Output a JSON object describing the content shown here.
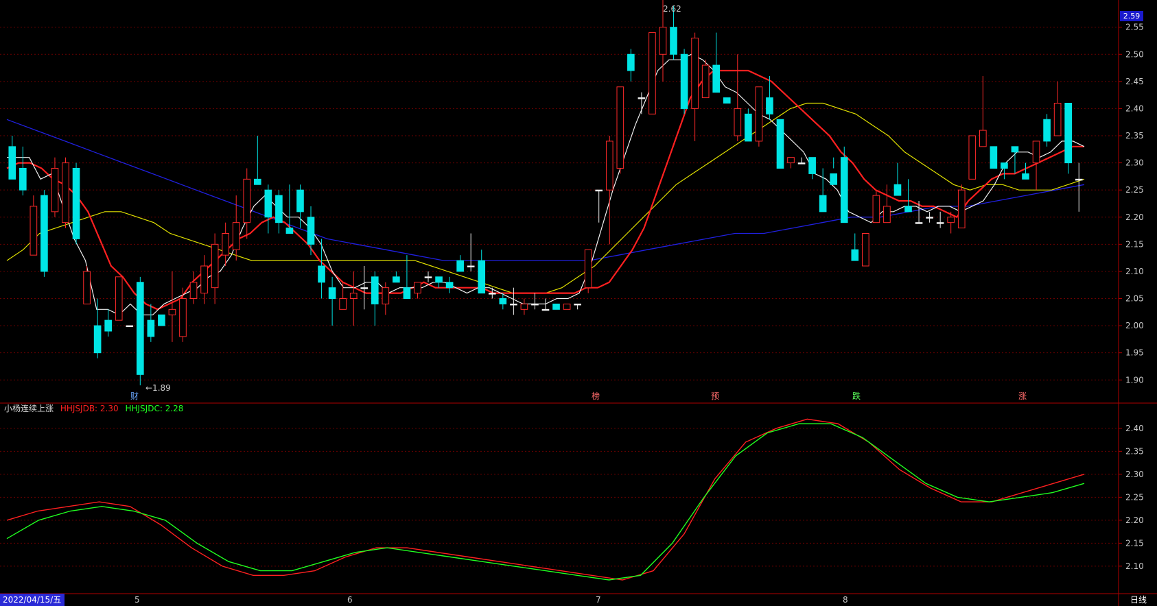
{
  "chart_data": [
    {
      "type": "candlestick",
      "panel": "main",
      "ylim": [
        1.87,
        2.59
      ],
      "y_ticks": [
        "2.55",
        "2.50",
        "2.45",
        "2.40",
        "2.35",
        "2.30",
        "2.25",
        "2.20",
        "2.15",
        "2.10",
        "2.05",
        "2.00",
        "1.95",
        "1.90"
      ],
      "current_price_label": "2.59",
      "annotations": {
        "high_label": "2.62",
        "low_label": "←1.89"
      },
      "candles": [
        [
          2.33,
          2.35,
          2.31,
          2.27
        ],
        [
          2.29,
          2.33,
          2.24,
          2.25
        ],
        [
          2.13,
          2.24,
          2.13,
          2.22
        ],
        [
          2.24,
          2.25,
          2.09,
          2.1
        ],
        [
          2.21,
          2.31,
          2.2,
          2.29
        ],
        [
          2.19,
          2.31,
          2.18,
          2.3
        ],
        [
          2.29,
          2.3,
          2.15,
          2.16
        ],
        [
          2.04,
          2.11,
          2.04,
          2.1
        ],
        [
          2.0,
          2.05,
          1.94,
          1.95
        ],
        [
          2.01,
          2.03,
          1.98,
          1.99
        ],
        [
          2.01,
          2.09,
          2.01,
          2.09
        ],
        [
          2.0,
          2.0,
          2.0,
          2.0
        ],
        [
          2.08,
          2.09,
          1.89,
          1.91
        ],
        [
          2.01,
          2.04,
          1.97,
          1.98
        ],
        [
          2.02,
          2.02,
          2.01,
          2.0
        ],
        [
          2.02,
          2.1,
          1.97,
          2.03
        ],
        [
          1.98,
          2.07,
          1.97,
          2.05
        ],
        [
          2.05,
          2.1,
          2.04,
          2.08
        ],
        [
          2.06,
          2.13,
          2.04,
          2.11
        ],
        [
          2.07,
          2.17,
          2.04,
          2.15
        ],
        [
          2.13,
          2.19,
          2.11,
          2.17
        ],
        [
          2.14,
          2.24,
          2.12,
          2.19
        ],
        [
          2.19,
          2.29,
          2.16,
          2.27
        ],
        [
          2.27,
          2.35,
          2.26,
          2.26
        ],
        [
          2.25,
          2.26,
          2.17,
          2.2
        ],
        [
          2.24,
          2.25,
          2.17,
          2.19
        ],
        [
          2.18,
          2.26,
          2.18,
          2.17
        ],
        [
          2.25,
          2.26,
          2.18,
          2.21
        ],
        [
          2.2,
          2.22,
          2.13,
          2.15
        ],
        [
          2.11,
          2.16,
          2.05,
          2.08
        ],
        [
          2.07,
          2.09,
          2.0,
          2.05
        ],
        [
          2.03,
          2.08,
          2.03,
          2.05
        ],
        [
          2.05,
          2.1,
          2.0,
          2.06
        ],
        [
          2.07,
          2.11,
          2.03,
          2.07
        ],
        [
          2.09,
          2.1,
          2.0,
          2.04
        ],
        [
          2.04,
          2.08,
          2.02,
          2.07
        ],
        [
          2.09,
          2.1,
          2.08,
          2.08
        ],
        [
          2.07,
          2.13,
          2.05,
          2.05
        ],
        [
          2.06,
          2.08,
          2.05,
          2.08
        ],
        [
          2.09,
          2.1,
          2.08,
          2.09
        ],
        [
          2.09,
          2.09,
          2.07,
          2.08
        ],
        [
          2.08,
          2.09,
          2.06,
          2.07
        ],
        [
          2.12,
          2.13,
          2.1,
          2.1
        ],
        [
          2.11,
          2.17,
          2.1,
          2.11
        ],
        [
          2.12,
          2.14,
          2.06,
          2.06
        ],
        [
          2.06,
          2.07,
          2.05,
          2.06
        ],
        [
          2.05,
          2.06,
          2.03,
          2.04
        ],
        [
          2.04,
          2.07,
          2.02,
          2.04
        ],
        [
          2.03,
          2.05,
          2.02,
          2.04
        ],
        [
          2.04,
          2.06,
          2.03,
          2.04
        ],
        [
          2.03,
          2.05,
          2.03,
          2.03
        ],
        [
          2.04,
          2.04,
          2.03,
          2.03
        ],
        [
          2.03,
          2.04,
          2.03,
          2.04
        ],
        [
          2.04,
          2.04,
          2.03,
          2.04
        ],
        [
          2.07,
          2.14,
          2.06,
          2.14
        ],
        [
          2.25,
          2.25,
          2.19,
          2.25
        ],
        [
          2.25,
          2.35,
          2.15,
          2.34
        ],
        [
          2.29,
          2.44,
          2.28,
          2.44
        ],
        [
          2.5,
          2.51,
          2.45,
          2.47
        ],
        [
          2.42,
          2.43,
          2.39,
          2.42
        ],
        [
          2.39,
          2.54,
          2.39,
          2.54
        ],
        [
          2.5,
          2.62,
          2.45,
          2.55
        ],
        [
          2.55,
          2.59,
          2.49,
          2.5
        ],
        [
          2.5,
          2.51,
          2.39,
          2.4
        ],
        [
          2.4,
          2.54,
          2.34,
          2.53
        ],
        [
          2.42,
          2.49,
          2.42,
          2.48
        ],
        [
          2.48,
          2.54,
          2.43,
          2.43
        ],
        [
          2.42,
          2.42,
          2.41,
          2.41
        ],
        [
          2.35,
          2.5,
          2.34,
          2.4
        ],
        [
          2.39,
          2.4,
          2.35,
          2.34
        ],
        [
          2.34,
          2.44,
          2.33,
          2.44
        ],
        [
          2.42,
          2.46,
          2.38,
          2.39
        ],
        [
          2.38,
          2.38,
          2.29,
          2.29
        ],
        [
          2.3,
          2.31,
          2.29,
          2.31
        ],
        [
          2.3,
          2.31,
          2.3,
          2.3
        ],
        [
          2.31,
          2.31,
          2.27,
          2.28
        ],
        [
          2.24,
          2.29,
          2.24,
          2.21
        ],
        [
          2.28,
          2.31,
          2.29,
          2.26
        ],
        [
          2.31,
          2.33,
          2.27,
          2.19
        ],
        [
          2.14,
          2.17,
          2.14,
          2.12
        ],
        [
          2.11,
          2.17,
          2.11,
          2.17
        ],
        [
          2.19,
          2.25,
          2.19,
          2.24
        ],
        [
          2.19,
          2.26,
          2.19,
          2.22
        ],
        [
          2.26,
          2.3,
          2.26,
          2.24
        ],
        [
          2.22,
          2.27,
          2.22,
          2.21
        ],
        [
          2.19,
          2.23,
          2.19,
          2.19
        ],
        [
          2.2,
          2.21,
          2.19,
          2.2
        ],
        [
          2.19,
          2.21,
          2.18,
          2.19
        ],
        [
          2.19,
          2.21,
          2.17,
          2.2
        ],
        [
          2.18,
          2.26,
          2.18,
          2.25
        ],
        [
          2.27,
          2.35,
          2.27,
          2.35
        ],
        [
          2.33,
          2.46,
          2.33,
          2.36
        ],
        [
          2.33,
          2.34,
          2.34,
          2.29
        ],
        [
          2.3,
          2.29,
          2.27,
          2.29
        ],
        [
          2.33,
          2.33,
          2.28,
          2.32
        ],
        [
          2.28,
          2.3,
          2.27,
          2.27
        ],
        [
          2.3,
          2.34,
          2.25,
          2.34
        ],
        [
          2.38,
          2.39,
          2.33,
          2.34
        ],
        [
          2.35,
          2.45,
          2.35,
          2.41
        ],
        [
          2.41,
          2.41,
          2.28,
          2.3
        ],
        [
          2.27,
          2.3,
          2.21,
          2.27
        ]
      ],
      "ma_white": [
        2.31,
        2.31,
        2.31,
        2.27,
        2.28,
        2.22,
        2.16,
        2.12,
        2.03,
        2.03,
        2.02,
        2.04,
        2.02,
        2.02,
        2.04,
        2.05,
        2.06,
        2.07,
        2.09,
        2.1,
        2.13,
        2.18,
        2.22,
        2.24,
        2.22,
        2.2,
        2.2,
        2.18,
        2.15,
        2.1,
        2.07,
        2.07,
        2.08,
        2.08,
        2.06,
        2.07,
        2.07,
        2.07,
        2.08,
        2.08,
        2.07,
        2.06,
        2.07,
        2.07,
        2.06,
        2.05,
        2.04,
        2.04,
        2.04,
        2.05,
        2.05,
        2.06,
        2.11,
        2.18,
        2.25,
        2.31,
        2.37,
        2.42,
        2.47,
        2.49,
        2.49,
        2.5,
        2.49,
        2.47,
        2.44,
        2.43,
        2.41,
        2.39,
        2.38,
        2.36,
        2.34,
        2.32,
        2.28,
        2.27,
        2.25,
        2.21,
        2.2,
        2.19,
        2.21,
        2.21,
        2.22,
        2.22,
        2.21,
        2.22,
        2.22,
        2.21,
        2.22,
        2.23,
        2.26,
        2.3,
        2.32,
        2.32,
        2.31,
        2.32,
        2.34,
        2.34,
        2.33
      ],
      "ma_red": [
        2.29,
        2.3,
        2.3,
        2.29,
        2.27,
        2.26,
        2.24,
        2.21,
        2.16,
        2.11,
        2.09,
        2.06,
        2.04,
        2.03,
        2.04,
        2.05,
        2.08,
        2.1,
        2.12,
        2.14,
        2.16,
        2.17,
        2.19,
        2.2,
        2.19,
        2.17,
        2.15,
        2.12,
        2.1,
        2.08,
        2.07,
        2.06,
        2.06,
        2.06,
        2.06,
        2.07,
        2.08,
        2.07,
        2.07,
        2.07,
        2.07,
        2.07,
        2.06,
        2.06,
        2.06,
        2.06,
        2.06,
        2.06,
        2.06,
        2.06,
        2.07,
        2.07,
        2.08,
        2.11,
        2.14,
        2.18,
        2.24,
        2.3,
        2.36,
        2.42,
        2.45,
        2.47,
        2.47,
        2.47,
        2.47,
        2.46,
        2.45,
        2.43,
        2.41,
        2.39,
        2.37,
        2.35,
        2.32,
        2.3,
        2.27,
        2.25,
        2.24,
        2.23,
        2.23,
        2.22,
        2.22,
        2.21,
        2.2,
        2.23,
        2.25,
        2.27,
        2.28,
        2.28,
        2.29,
        2.3,
        2.31,
        2.32,
        2.33,
        2.33
      ],
      "ma_yellow": [
        2.12,
        2.14,
        2.17,
        2.18,
        2.19,
        2.2,
        2.21,
        2.21,
        2.2,
        2.19,
        2.17,
        2.16,
        2.15,
        2.14,
        2.13,
        2.12,
        2.12,
        2.12,
        2.12,
        2.12,
        2.12,
        2.12,
        2.12,
        2.12,
        2.12,
        2.12,
        2.11,
        2.1,
        2.09,
        2.08,
        2.07,
        2.06,
        2.06,
        2.06,
        2.07,
        2.09,
        2.11,
        2.14,
        2.17,
        2.2,
        2.23,
        2.26,
        2.28,
        2.3,
        2.32,
        2.34,
        2.36,
        2.38,
        2.4,
        2.41,
        2.41,
        2.4,
        2.39,
        2.37,
        2.35,
        2.32,
        2.3,
        2.28,
        2.26,
        2.25,
        2.26,
        2.26,
        2.25,
        2.25,
        2.25,
        2.26,
        2.27
      ],
      "ma_blue": [
        2.38,
        2.36,
        2.34,
        2.32,
        2.3,
        2.28,
        2.26,
        2.24,
        2.22,
        2.2,
        2.18,
        2.16,
        2.15,
        2.14,
        2.13,
        2.12,
        2.12,
        2.12,
        2.12,
        2.12,
        2.12,
        2.13,
        2.14,
        2.15,
        2.16,
        2.17,
        2.17,
        2.18,
        2.19,
        2.2,
        2.2,
        2.21,
        2.22,
        2.22,
        2.23,
        2.24,
        2.25,
        2.26
      ],
      "event_markers": [
        {
          "label": "财",
          "color": "#6aa8ff"
        },
        {
          "label": "榜",
          "color": "#ff6b6b"
        },
        {
          "label": "预",
          "color": "#ff6b6b"
        },
        {
          "label": "跌",
          "color": "#5bff5b"
        },
        {
          "label": "涨",
          "color": "#ff6b6b"
        }
      ]
    },
    {
      "type": "line",
      "panel": "indicator",
      "title": "小杨连续上涨",
      "ylim": [
        2.07,
        2.44
      ],
      "y_ticks": [
        "2.40",
        "2.35",
        "2.30",
        "2.25",
        "2.20",
        "2.15",
        "2.10"
      ],
      "series": [
        {
          "name": "HHJSJDB",
          "label": "HHJSJDB: 2.30",
          "color": "#ff2020",
          "values": [
            2.2,
            2.22,
            2.23,
            2.24,
            2.23,
            2.19,
            2.14,
            2.1,
            2.08,
            2.08,
            2.09,
            2.12,
            2.14,
            2.14,
            2.13,
            2.12,
            2.11,
            2.1,
            2.09,
            2.08,
            2.07,
            2.09,
            2.17,
            2.29,
            2.37,
            2.4,
            2.42,
            2.41,
            2.37,
            2.31,
            2.27,
            2.24,
            2.24,
            2.26,
            2.28,
            2.3
          ]
        },
        {
          "name": "HHJSJDC",
          "label": "HHJSJDC: 2.28",
          "color": "#20ff20",
          "values": [
            2.16,
            2.2,
            2.22,
            2.23,
            2.22,
            2.2,
            2.15,
            2.11,
            2.09,
            2.09,
            2.11,
            2.13,
            2.14,
            2.13,
            2.12,
            2.11,
            2.1,
            2.09,
            2.08,
            2.07,
            2.08,
            2.15,
            2.25,
            2.34,
            2.39,
            2.41,
            2.41,
            2.38,
            2.33,
            2.28,
            2.25,
            2.24,
            2.25,
            2.26,
            2.28
          ]
        }
      ]
    }
  ],
  "x_axis": {
    "date_label": "2022/04/15/五",
    "month_labels": [
      "5",
      "6",
      "7",
      "8"
    ],
    "period_label": "日线"
  },
  "colors": {
    "up": "#ff2a2a",
    "down": "#00e5e5",
    "grid": "#6b0000",
    "axis": "#b00000"
  }
}
